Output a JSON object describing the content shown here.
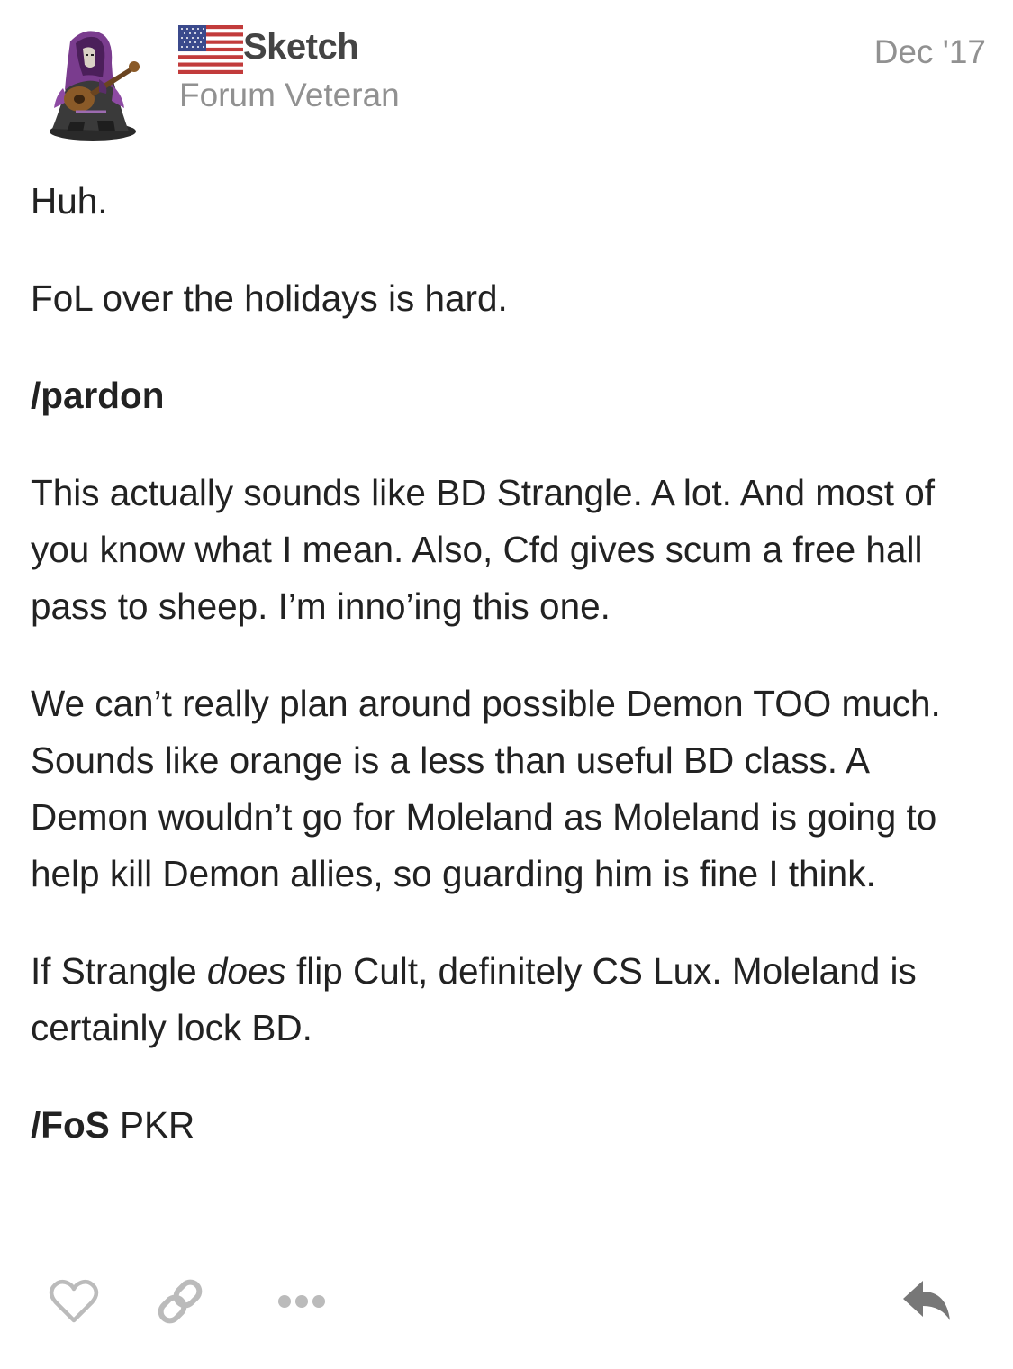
{
  "post": {
    "username": "Sketch",
    "user_title": "Forum Veteran",
    "date": "Dec '17",
    "flag_icon": "us-flag-icon",
    "paragraphs": {
      "p1": "Huh.",
      "p2": "FoL over the holidays is hard.",
      "p3_bold": "/pardon",
      "p4": "This actually sounds like BD Strangle. A lot. And most of you know what I mean. Also, Cfd gives scum a free hall pass to sheep. I’m inno’ing this one.",
      "p5": "We can’t really plan around possible Demon TOO much. Sounds like orange is a less than useful BD class. A Demon wouldn’t go for Moleland as Moleland is going to help kill Demon allies, so guarding him is fine I think.",
      "p6_before": "If Strangle ",
      "p6_italic": "does",
      "p6_after": " flip Cult, definitely CS Lux. Moleland is certainly lock BD.",
      "p7_bold": "/FoS",
      "p7_after": " PKR"
    }
  },
  "actions": {
    "like_icon": "heart-icon",
    "link_icon": "link-icon",
    "more_icon": "ellipsis-icon",
    "reply_icon": "reply-icon",
    "icon_color": "#bbbbbb",
    "reply_color": "#777777"
  }
}
